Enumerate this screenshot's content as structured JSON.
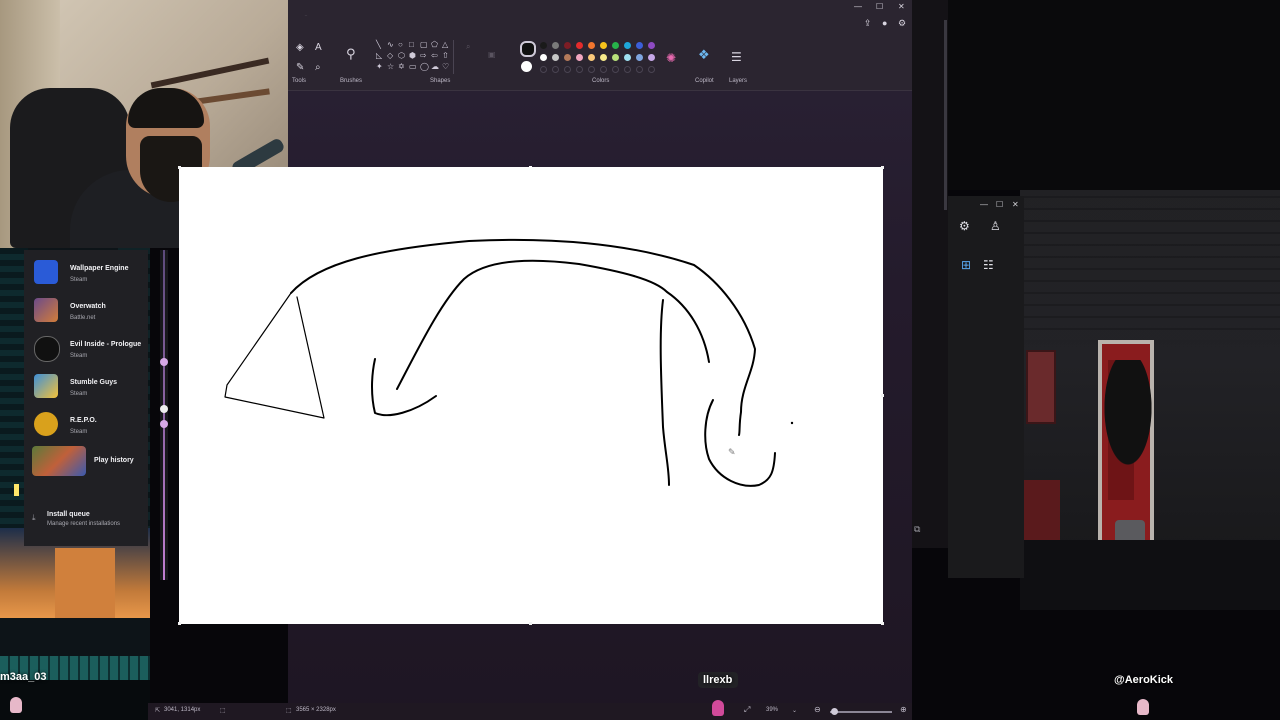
{
  "launcher": {
    "games": [
      {
        "name": "Wallpaper Engine",
        "sub": "Steam",
        "color": "#2a5bd7"
      },
      {
        "name": "Overwatch",
        "sub": "Battle.net",
        "color": "#6b4a8a"
      },
      {
        "name": "Evil Inside - Prologue",
        "sub": "Steam",
        "color": "#111111"
      },
      {
        "name": "Stumble Guys",
        "sub": "Steam",
        "color": "#3d8fd8"
      },
      {
        "name": "R.E.P.O.",
        "sub": "Steam",
        "color": "#d9a11c"
      },
      {
        "name": "Play history",
        "sub": "",
        "color": "#5b7a3a"
      }
    ],
    "install_queue": {
      "title": "Install queue",
      "sub": "Manage recent installations"
    }
  },
  "paint": {
    "groups": {
      "tools": "Tools",
      "brushes": "Brushes",
      "shapes": "Shapes",
      "colors": "Colors",
      "copilot": "Copilot",
      "layers": "Layers"
    },
    "palette_row1": [
      "#1a1a1a",
      "#7a7a7a",
      "#7d1d25",
      "#e32b2b",
      "#f2762e",
      "#f6c21c",
      "#27b24a",
      "#1ea7d8",
      "#3b5fd8",
      "#8e4bc2"
    ],
    "palette_row2": [
      "#ffffff",
      "#c6c6c6",
      "#b57a5a",
      "#f2a6c0",
      "#f9c87a",
      "#f5e98a",
      "#b7e07a",
      "#9fe0f0",
      "#7fa6e0",
      "#c6a8e8"
    ],
    "status": {
      "cursor": "3041, 1314px",
      "canvas_size": "3565 × 2328px",
      "zoom": "39%"
    }
  },
  "overlays": {
    "left_name": "m3aa_03",
    "center_name": "llrexb",
    "right_name": "@AeroKick"
  }
}
